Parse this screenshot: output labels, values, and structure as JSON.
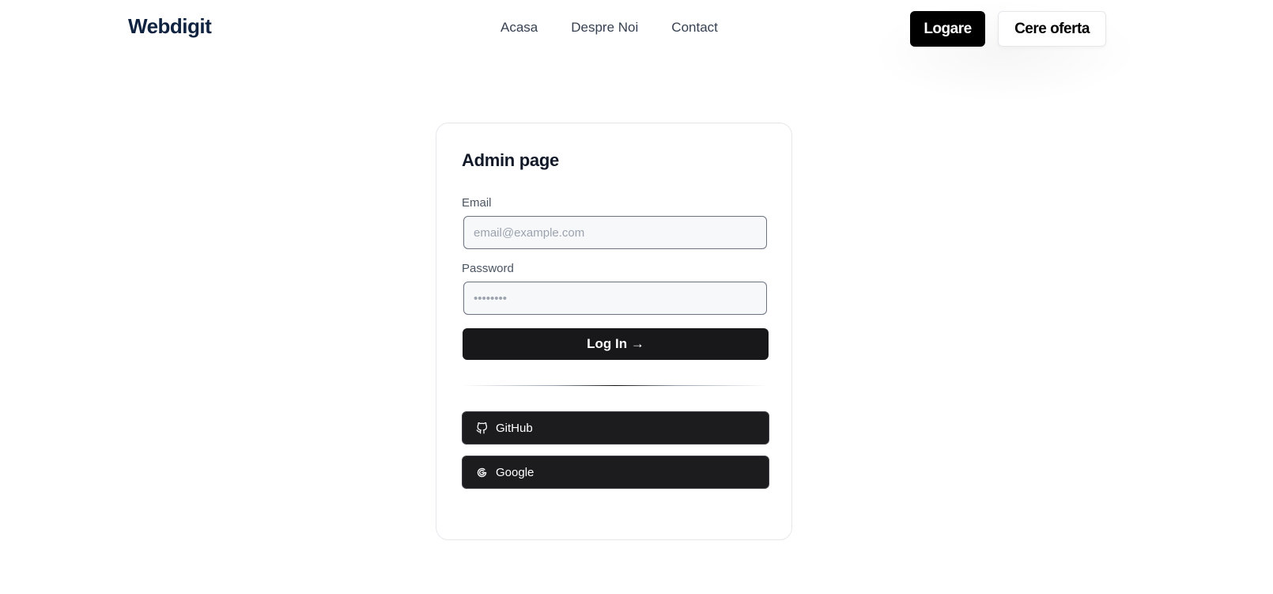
{
  "header": {
    "logo": "Webdigit",
    "nav": [
      "Acasa",
      "Despre Noi",
      "Contact"
    ],
    "login_label": "Logare",
    "offer_label": "Cere oferta"
  },
  "form": {
    "title": "Admin page",
    "email_label": "Email",
    "email_placeholder": "email@example.com",
    "password_label": "Password",
    "password_placeholder": "••••••••",
    "submit_label": "Log In →",
    "github_label": "GitHub",
    "google_label": "Google"
  },
  "colors": {
    "logo": "#0f2340",
    "primary_button": "#18181b",
    "header_button": "#000000"
  },
  "icons": {
    "github": "github-icon",
    "google": "google-icon"
  }
}
